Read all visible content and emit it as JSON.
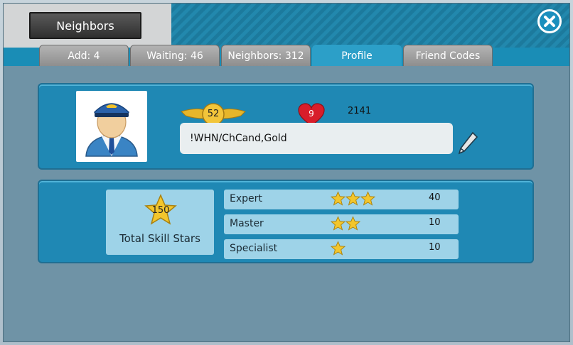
{
  "window": {
    "title": "Neighbors"
  },
  "tabs": [
    {
      "label": "Add: 4",
      "active": false
    },
    {
      "label": "Waiting: 46",
      "active": false
    },
    {
      "label": "Neighbors: 312",
      "active": false
    },
    {
      "label": "Profile",
      "active": true
    },
    {
      "label": "Friend Codes",
      "active": false
    }
  ],
  "profile": {
    "avatar": "pilot-avatar",
    "level": "52",
    "hearts": "9",
    "stat": "2141",
    "name": "!WHN/ChCand,Gold",
    "edit_icon": "pencil-icon"
  },
  "skills": {
    "total": "150",
    "total_label": "Total Skill Stars",
    "rows": [
      {
        "name": "Expert",
        "stars": 3,
        "count": "40"
      },
      {
        "name": "Master",
        "stars": 2,
        "count": "10"
      },
      {
        "name": "Specialist",
        "stars": 1,
        "count": "10"
      }
    ]
  },
  "colors": {
    "accent": "#1f88b4",
    "panel": "#6f93a6",
    "active_tab": "#2c9fc8",
    "heart": "#d81d2a",
    "star": "#f3c62c"
  }
}
